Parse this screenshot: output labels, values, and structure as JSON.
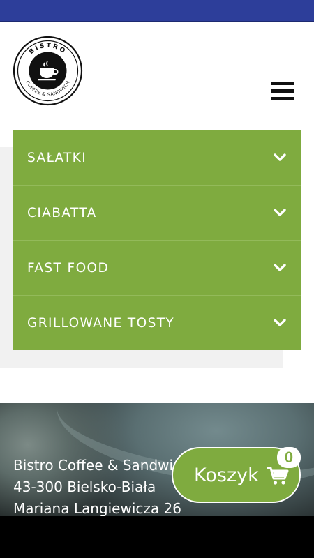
{
  "brand": {
    "logo_top_text": "BISTRO",
    "logo_bottom_text": "COFFEE & SANDWICH"
  },
  "header": {
    "menu_icon": "hamburger-icon"
  },
  "menu": {
    "items": [
      {
        "label": "SAŁATKI",
        "icon": "chevron-down-icon"
      },
      {
        "label": "CIABATTA",
        "icon": "chevron-down-icon"
      },
      {
        "label": "FAST FOOD",
        "icon": "chevron-down-icon"
      },
      {
        "label": "GRILLOWANE TOSTY",
        "icon": "chevron-down-icon"
      }
    ]
  },
  "footer": {
    "name": "Bistro Coffee & Sandwich",
    "city": "43-300 Bielsko-Biała",
    "street": "Mariana Langiewicza 26"
  },
  "cart": {
    "label": "Koszyk",
    "count": "0",
    "icon": "cart-icon"
  },
  "colors": {
    "accent": "#7fab3f",
    "top_strip": "#2d3e9a",
    "panel_gray": "#f1f1f1"
  }
}
